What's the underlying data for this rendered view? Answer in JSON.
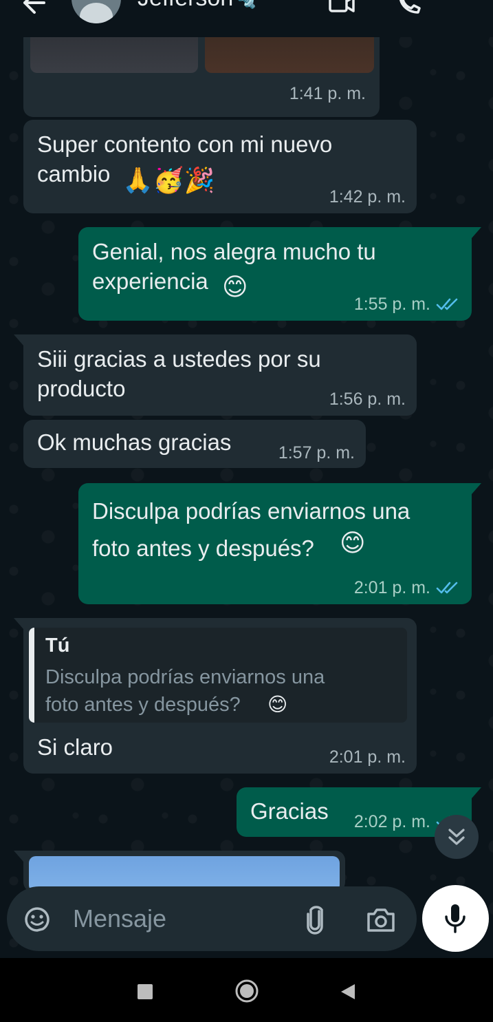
{
  "header": {
    "contact_name": "Jefferson",
    "contact_emoji": "🔩",
    "icons": [
      "back-arrow-icon",
      "avatar",
      "video-call-icon",
      "phone-icon",
      "more-options-icon"
    ]
  },
  "messages": [
    {
      "direction": "incoming",
      "type": "image",
      "time": "1:41 p. m."
    },
    {
      "direction": "incoming",
      "text": "Super contento con mi nuevo\ncambio",
      "emoji": "🙏🥳🎉",
      "time": "1:42 p. m."
    },
    {
      "direction": "outgoing",
      "text": "Genial, nos alegra mucho tu\nexperiencia",
      "emoji": "😊",
      "time": "1:55 p. m.",
      "status": "read"
    },
    {
      "direction": "incoming",
      "text": "Siii gracias a ustedes por su\nproducto",
      "time": "1:56 p. m."
    },
    {
      "direction": "incoming",
      "text": "Ok muchas gracias",
      "time": "1:57 p. m."
    },
    {
      "direction": "outgoing",
      "text": "Disculpa podrías enviarnos una\nfoto antes y después?",
      "emoji": "😊",
      "time": "2:01 p. m.",
      "status": "read"
    },
    {
      "direction": "incoming",
      "quote": {
        "author": "Tú",
        "text": "Disculpa podrías enviarnos una\nfoto antes y después?",
        "emoji": "😊"
      },
      "text": "Si claro",
      "time": "2:01 p. m."
    },
    {
      "direction": "outgoing",
      "text": "Gracias",
      "time": "2:02 p. m.",
      "status": "read"
    },
    {
      "direction": "incoming",
      "type": "image"
    }
  ],
  "composer": {
    "placeholder": "Mensaje",
    "icons": [
      "sticker-icon",
      "attach-icon",
      "camera-icon",
      "mic-icon"
    ]
  },
  "colors": {
    "background": "#0b141a",
    "incoming_bubble": "#202c33",
    "outgoing_bubble": "#005c4b",
    "read_ticks": "#53bdeb"
  }
}
